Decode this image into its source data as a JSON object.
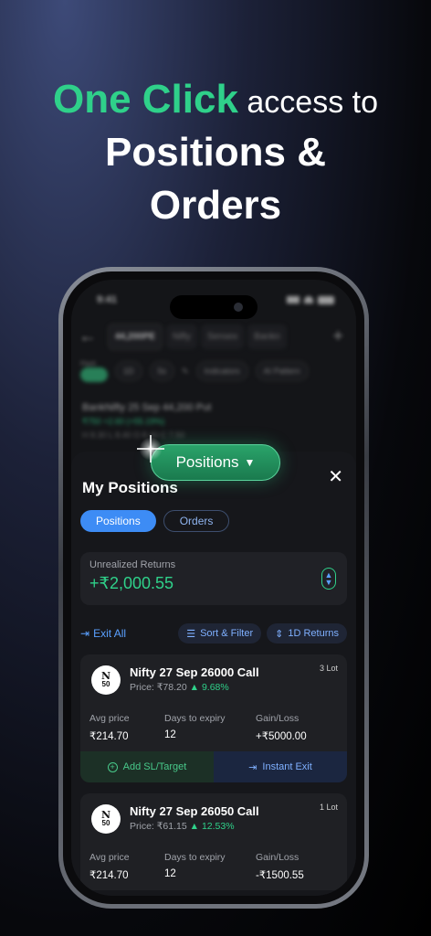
{
  "headline": {
    "accent": "One Click",
    "rest": " access to",
    "line2": "Positions &",
    "line3": "Orders"
  },
  "status_bar": {
    "time": "9:41"
  },
  "bg_app": {
    "tabs": [
      "44,200PE",
      "Nifty",
      "Sensex",
      "Bankn"
    ],
    "flash_label": "Flash",
    "tool_chips": [
      "1D",
      "5s",
      "Indicators",
      "AI Pattern"
    ],
    "instrument_title": "BankNifty 25 Sep 44,200 Put",
    "instrument_change": "₹750  +2.60 (+55.19%)",
    "instrument_sub": "H 8.30  L 8.40  O 8.40  C 7.50"
  },
  "positions_button": {
    "label": "Positions",
    "icon": "chevron-down-icon"
  },
  "sheet": {
    "title": "My Positions",
    "close_icon": "close-icon",
    "tabs": [
      {
        "label": "Positions",
        "active": true
      },
      {
        "label": "Orders",
        "active": false
      }
    ],
    "unrealized": {
      "label": "Unrealized Returns",
      "value": "+₹2,000.55"
    },
    "actions": {
      "exit_all": "Exit All",
      "sort_filter": "Sort & Filter",
      "returns": "1D Returns"
    },
    "positions": [
      {
        "logo_line1": "N",
        "logo_line2": "50",
        "name": "Nifty 27 Sep 26000 Call",
        "price": "Price: ₹78.20",
        "change": "▲ 9.68%",
        "lot": "3 Lot",
        "avg_label": "Avg price",
        "avg": "₹214.70",
        "days_label": "Days to expiry",
        "days": "12",
        "gain_label": "Gain/Loss",
        "gain": "+₹5000.00",
        "add_sl": "Add SL/Target",
        "instant_exit": "Instant Exit"
      },
      {
        "logo_line1": "N",
        "logo_line2": "50",
        "name": "Nifty 27 Sep 26050 Call",
        "price": "Price: ₹61.15",
        "change": "▲ 12.53%",
        "lot": "1 Lot",
        "avg_label": "Avg price",
        "avg": "₹214.70",
        "days_label": "Days to expiry",
        "days": "12",
        "gain_label": "Gain/Loss",
        "gain": "-₹1500.55"
      }
    ]
  },
  "colors": {
    "accent_green": "#2fd18a",
    "accent_blue": "#3d8cf5",
    "loss_red": "#ff4d5a"
  }
}
